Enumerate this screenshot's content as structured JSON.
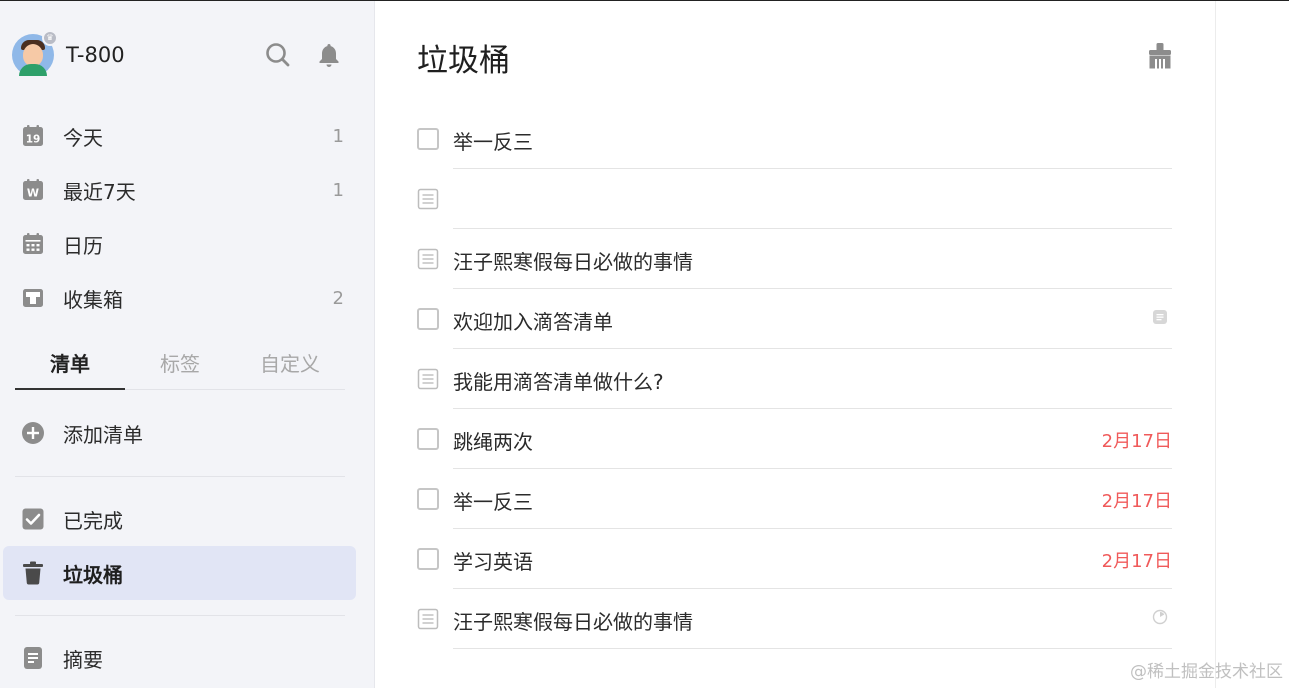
{
  "user": {
    "name": "T-800"
  },
  "sidebar": {
    "smart_lists": [
      {
        "label": "今天",
        "count": "1",
        "icon": "calendar-19-icon",
        "icon_text": "19"
      },
      {
        "label": "最近7天",
        "count": "1",
        "icon": "calendar-week-icon",
        "icon_text": "W"
      },
      {
        "label": "日历",
        "count": "",
        "icon": "calendar-grid-icon"
      },
      {
        "label": "收集箱",
        "count": "2",
        "icon": "inbox-icon"
      }
    ],
    "tabs": [
      {
        "label": "清单",
        "active": true
      },
      {
        "label": "标签",
        "active": false
      },
      {
        "label": "自定义",
        "active": false
      }
    ],
    "add_list": {
      "label": "添加清单",
      "icon": "plus-circle-icon"
    },
    "completed": {
      "label": "已完成",
      "icon": "checkbox-checked-icon"
    },
    "trash": {
      "label": "垃圾桶",
      "icon": "trash-icon",
      "active": true
    },
    "summary": {
      "label": "摘要",
      "icon": "document-icon"
    }
  },
  "main": {
    "title": "垃圾桶",
    "tasks": [
      {
        "title": "举一反三",
        "kind": "checkbox",
        "date": "",
        "meta_icon": ""
      },
      {
        "title": "",
        "kind": "note",
        "date": "",
        "meta_icon": ""
      },
      {
        "title": "汪子熙寒假每日必做的事情",
        "kind": "note",
        "date": "",
        "meta_icon": ""
      },
      {
        "title": "欢迎加入滴答清单",
        "kind": "checkbox",
        "date": "",
        "meta_icon": "note-small-icon"
      },
      {
        "title": "我能用滴答清单做什么?",
        "kind": "note",
        "date": "",
        "meta_icon": ""
      },
      {
        "title": "跳绳两次",
        "kind": "checkbox",
        "date": "2月17日",
        "meta_icon": ""
      },
      {
        "title": "举一反三",
        "kind": "checkbox",
        "date": "2月17日",
        "meta_icon": ""
      },
      {
        "title": "学习英语",
        "kind": "checkbox",
        "date": "2月17日",
        "meta_icon": ""
      },
      {
        "title": "汪子熙寒假每日必做的事情",
        "kind": "note",
        "date": "",
        "meta_icon": "progress-circle-icon"
      }
    ]
  },
  "colors": {
    "accent_active": "#e1e5f5",
    "date_overdue": "#f05a5a",
    "sidebar_bg": "#f3f4f8"
  },
  "watermark": "@稀土掘金技术社区"
}
